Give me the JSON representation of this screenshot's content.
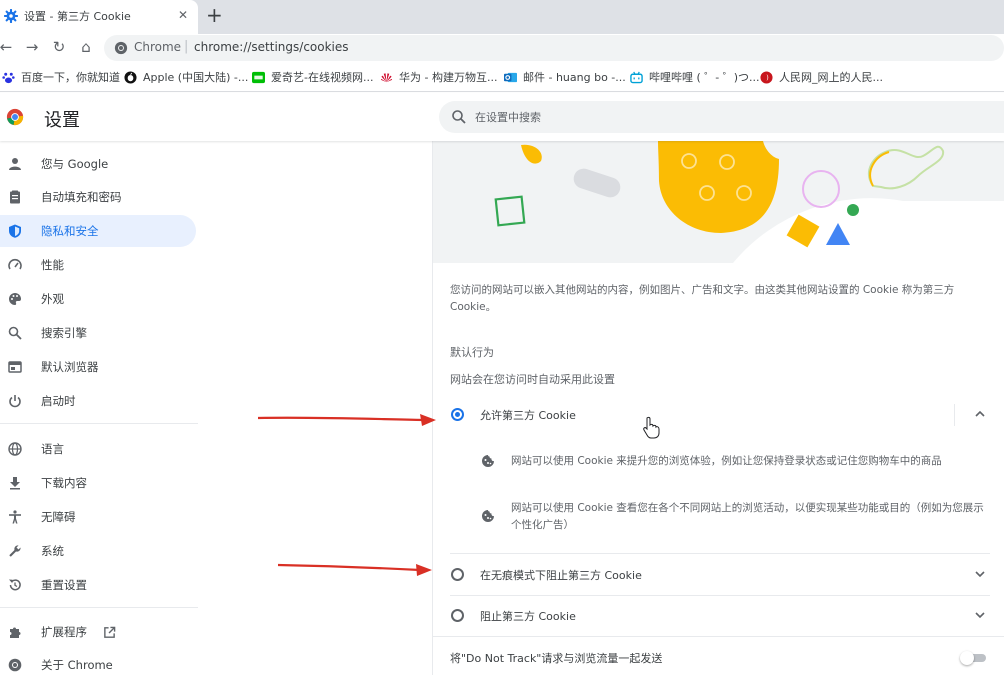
{
  "tab": {
    "title": "设置 - 第三方 Cookie",
    "close": "✕",
    "new_tab": "+"
  },
  "toolbar": {
    "back": "←",
    "forward": "→",
    "reload": "↻",
    "home": "⌂",
    "site_label": "Chrome",
    "separator": "|",
    "url": "chrome://settings/cookies"
  },
  "bookmarks": [
    {
      "label": "百度一下，你就知道",
      "icon": "baidu-icon",
      "color": "#2932e1"
    },
    {
      "label": "Apple (中国大陆) -...",
      "icon": "apple-icon",
      "color": "#111111"
    },
    {
      "label": "爱奇艺-在线视频网...",
      "icon": "iqiyi-icon",
      "color": "#00be06"
    },
    {
      "label": "华为 - 构建万物互...",
      "icon": "huawei-icon",
      "color": "#cf0a2c"
    },
    {
      "label": "邮件 - huang bo -...",
      "icon": "outlook-icon",
      "color": "#0f6cbd"
    },
    {
      "label": "哔哩哔哩 ( ゜- ゜)つ...",
      "icon": "bilibili-icon",
      "color": "#00a1d6"
    },
    {
      "label": "人民网_网上的人民...",
      "icon": "people-icon",
      "color": "#c8161d"
    }
  ],
  "header": {
    "title": "设置",
    "search_placeholder": "在设置中搜索"
  },
  "sidebar": {
    "items": [
      {
        "label": "您与 Google",
        "icon": "person-icon"
      },
      {
        "label": "自动填充和密码",
        "icon": "clipboard-icon"
      },
      {
        "label": "隐私和安全",
        "icon": "shield-icon",
        "active": true
      },
      {
        "label": "性能",
        "icon": "speedometer-icon"
      },
      {
        "label": "外观",
        "icon": "palette-icon"
      },
      {
        "label": "搜索引擎",
        "icon": "search-icon"
      },
      {
        "label": "默认浏览器",
        "icon": "browser-icon"
      },
      {
        "label": "启动时",
        "icon": "power-icon"
      },
      {
        "label": "语言",
        "icon": "globe-icon"
      },
      {
        "label": "下载内容",
        "icon": "download-icon"
      },
      {
        "label": "无障碍",
        "icon": "accessibility-icon"
      },
      {
        "label": "系统",
        "icon": "wrench-icon"
      },
      {
        "label": "重置设置",
        "icon": "reset-icon"
      },
      {
        "label": "扩展程序",
        "icon": "puzzle-icon"
      },
      {
        "label": "关于 Chrome",
        "icon": "chrome-icon"
      }
    ]
  },
  "main": {
    "description": "您访问的网站可以嵌入其他网站的内容，例如图片、广告和文字。由这类其他网站设置的 Cookie 称为第三方 Cookie。",
    "default_behavior_title": "默认行为",
    "default_behavior_subtitle": "网站会在您访问时自动采用此设置",
    "options": [
      {
        "label": "允许第三方 Cookie",
        "selected": true,
        "expanded": true,
        "details": [
          "网站可以使用 Cookie 来提升您的浏览体验，例如让您保持登录状态或记住您购物车中的商品",
          "网站可以使用 Cookie 查看您在各个不同网站上的浏览活动，以便实现某些功能或目的（例如为您展示个性化广告）"
        ]
      },
      {
        "label": "在无痕模式下阻止第三方 Cookie",
        "selected": false,
        "expanded": false
      },
      {
        "label": "阻止第三方 Cookie",
        "selected": false,
        "expanded": false
      }
    ],
    "dnt_label": "将\"Do Not Track\"请求与浏览流量一起发送",
    "dnt_enabled": false
  },
  "colors": {
    "accent": "#1a73e8",
    "annotation_arrow": "#d93025"
  }
}
